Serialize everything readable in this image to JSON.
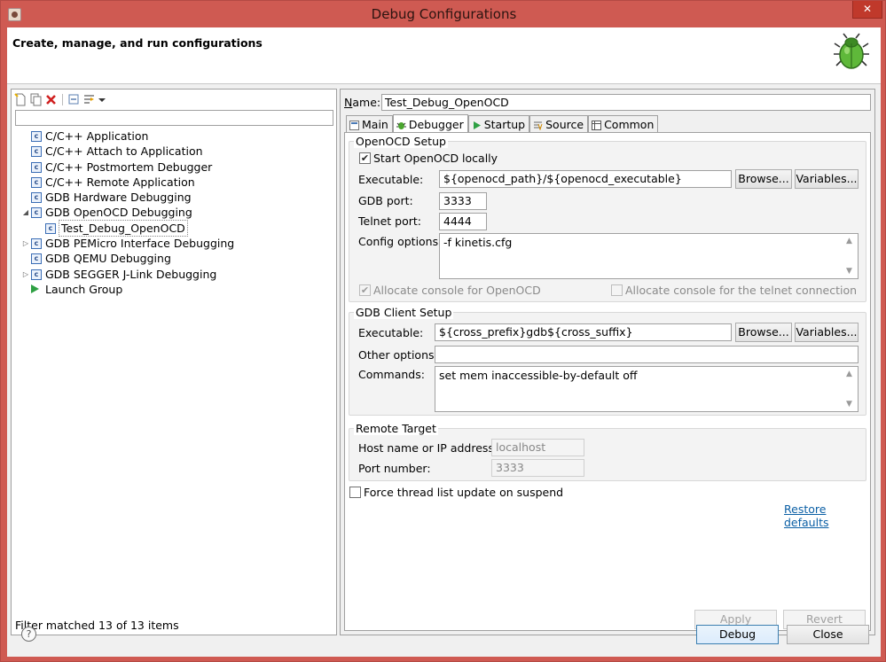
{
  "window": {
    "title": "Debug Configurations",
    "close_glyph": "✕"
  },
  "header": {
    "title": "Create, manage, and run configurations",
    "icon": "bug-icon"
  },
  "left": {
    "tree": [
      {
        "label": "C/C++ Application",
        "level": 0,
        "expander": "",
        "icon": "config-icon"
      },
      {
        "label": "C/C++ Attach to Application",
        "level": 0,
        "expander": "",
        "icon": "config-icon"
      },
      {
        "label": "C/C++ Postmortem Debugger",
        "level": 0,
        "expander": "",
        "icon": "config-icon"
      },
      {
        "label": "C/C++ Remote Application",
        "level": 0,
        "expander": "",
        "icon": "config-icon"
      },
      {
        "label": "GDB Hardware Debugging",
        "level": 0,
        "expander": "",
        "icon": "config-icon"
      },
      {
        "label": "GDB OpenOCD Debugging",
        "level": 0,
        "expander": "◢",
        "icon": "config-icon"
      },
      {
        "label": "Test_Debug_OpenOCD",
        "level": 1,
        "expander": "",
        "icon": "config-icon",
        "selected": true
      },
      {
        "label": "GDB PEMicro Interface Debugging",
        "level": 0,
        "expander": "▷",
        "icon": "config-icon"
      },
      {
        "label": "GDB QEMU Debugging",
        "level": 0,
        "expander": "",
        "icon": "config-icon"
      },
      {
        "label": "GDB SEGGER J-Link Debugging",
        "level": 0,
        "expander": "▷",
        "icon": "config-icon"
      },
      {
        "label": "Launch Group",
        "level": 0,
        "expander": "",
        "icon": "launch-icon"
      }
    ],
    "filter_status": "Filter matched 13 of 13 items"
  },
  "right": {
    "name_label_prefix": "N",
    "name_label_rest": "ame:",
    "name_value": "Test_Debug_OpenOCD",
    "tabs": [
      "Main",
      "Debugger",
      "Startup",
      "Source",
      "Common"
    ],
    "openocd": {
      "title": "OpenOCD Setup",
      "start_locally": "Start OpenOCD locally",
      "executable_label": "Executable:",
      "executable_value": "${openocd_path}/${openocd_executable}",
      "gdb_port_label": "GDB port:",
      "gdb_port_value": "3333",
      "telnet_port_label": "Telnet port:",
      "telnet_port_value": "4444",
      "config_label": "Config options:",
      "config_value": "-f kinetis.cfg",
      "alloc_console": "Allocate console for OpenOCD",
      "alloc_telnet": "Allocate console for the telnet connection"
    },
    "gdb": {
      "title": "GDB Client Setup",
      "executable_label": "Executable:",
      "executable_value": "${cross_prefix}gdb${cross_suffix}",
      "other_label": "Other options:",
      "other_value": "",
      "commands_label": "Commands:",
      "commands_value": "set mem inaccessible-by-default off"
    },
    "remote": {
      "title": "Remote Target",
      "host_label": "Host name or IP address:",
      "host_value": "localhost",
      "port_label": "Port number:",
      "port_value": "3333"
    },
    "force_thread": "Force thread list update on suspend",
    "restore_defaults": "Restore defaults",
    "browse": "Browse...",
    "variables": "Variables...",
    "apply": "Apply",
    "revert": "Revert"
  },
  "footer": {
    "debug": "Debug",
    "close": "Close",
    "help": "?"
  }
}
